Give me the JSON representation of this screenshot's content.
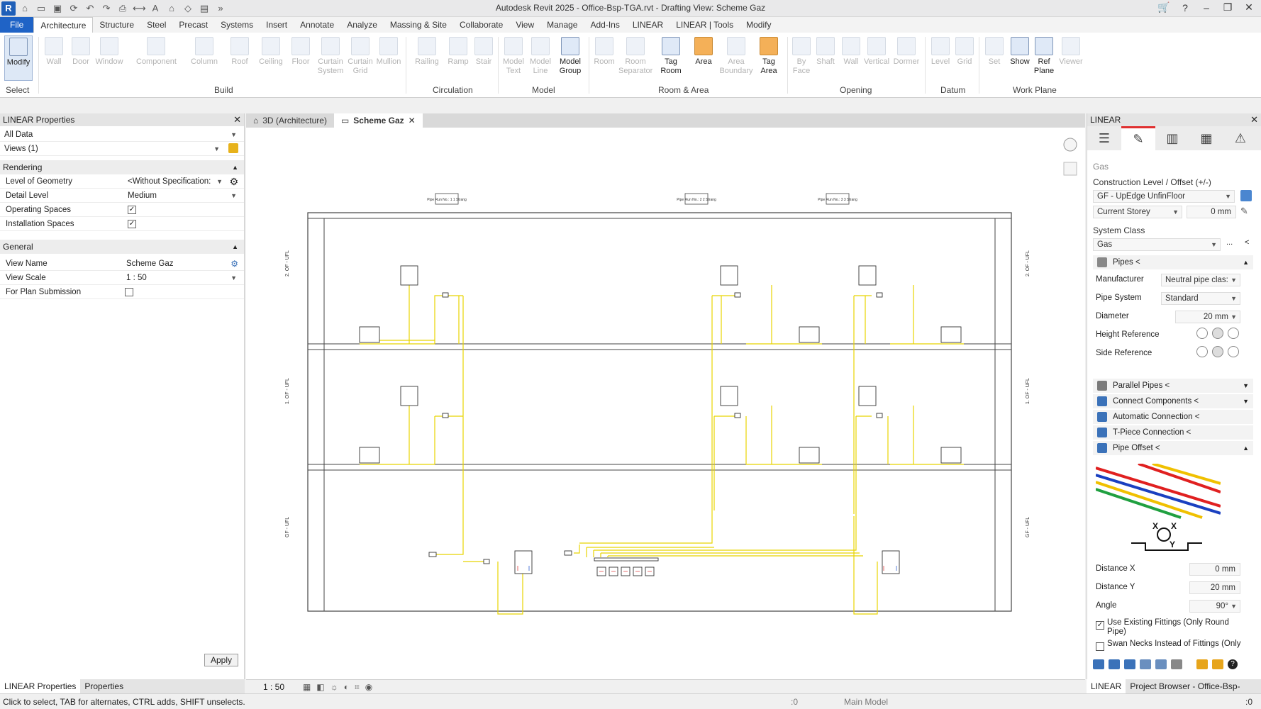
{
  "window": {
    "title": "Autodesk Revit 2025 - Office-Bsp-TGA.rvt - Drafting View: Scheme Gaz",
    "logo": "R"
  },
  "menu": {
    "tabs": [
      "File",
      "Architecture",
      "Structure",
      "Steel",
      "Precast",
      "Systems",
      "Insert",
      "Annotate",
      "Analyze",
      "Massing & Site",
      "Collaborate",
      "View",
      "Manage",
      "Add-Ins",
      "LINEAR",
      "LINEAR | Tools",
      "Modify"
    ],
    "active": "Architecture"
  },
  "ribbon": {
    "select_panel": "Select",
    "modify": "Modify",
    "build_items": [
      "Wall",
      "Door",
      "Window",
      "Component",
      "Column",
      "Roof",
      "Ceiling",
      "Floor",
      "Curtain System",
      "Curtain Grid",
      "Mullion"
    ],
    "build_panel": "Build",
    "circulation_items": [
      "Railing",
      "Ramp",
      "Stair"
    ],
    "circulation_panel": "Circulation",
    "model_items": [
      "Model Text",
      "Model Line",
      "Model Group"
    ],
    "model_panel": "Model",
    "room_items": [
      "Room",
      "Room Separator",
      "Tag Room",
      "Area",
      "Area Boundary",
      "Tag Area"
    ],
    "room_panel": "Room & Area",
    "opening_items": [
      "By Face",
      "Shaft",
      "Wall",
      "Vertical",
      "Dormer"
    ],
    "opening_panel": "Opening",
    "datum_items": [
      "Level",
      "Grid"
    ],
    "datum_panel": "Datum",
    "workplane_items": [
      "Set",
      "Show",
      "Ref Plane",
      "Viewer"
    ],
    "workplane_panel": "Work Plane"
  },
  "left_panel": {
    "title": "LINEAR Properties",
    "filter": "All Data",
    "views": "Views (1)",
    "rendering": {
      "heading": "Rendering",
      "rows": [
        {
          "key": "Level of Geometry",
          "value": "<Without Specification:"
        },
        {
          "key": "Detail Level",
          "value": "Medium"
        },
        {
          "key": "Operating Spaces",
          "value": "✓"
        },
        {
          "key": "Installation Spaces",
          "value": "✓"
        }
      ]
    },
    "general": {
      "heading": "General",
      "rows": [
        {
          "key": "View Name",
          "value": "Scheme Gaz"
        },
        {
          "key": "View Scale",
          "value": "1 : 50"
        },
        {
          "key": "For Plan Submission",
          "value": ""
        }
      ]
    },
    "apply": "Apply",
    "bottom_tabs": [
      "LINEAR Properties",
      "Properties"
    ]
  },
  "doc_tabs": [
    {
      "label": "3D (Architecture)",
      "active": false
    },
    {
      "label": "Scheme Gaz",
      "active": true
    }
  ],
  "drawing": {
    "level_labels": [
      "2. OF - UFL",
      "1. OF - UFL",
      "GF - UFL"
    ],
    "pipe_run_tags": [
      "Pipe Run No.: 1\n1 Strang",
      "Pipe Run No.: 2\n2 Strang",
      "Pipe Run No.: 3\n3 Strang"
    ],
    "pipe_color": "#e8d400"
  },
  "view_bar": {
    "scale": "1 : 50"
  },
  "right_panel": {
    "title": "LINEAR",
    "tab_icons": [
      "menu-icon",
      "edit-icon",
      "columns-icon",
      "calculator-icon",
      "warning-icon"
    ],
    "category": "Gas",
    "construction_label": "Construction Level / Offset (+/-)",
    "construction_level": "GF - UpEdge UnfinFloor",
    "storey": "Current Storey",
    "offset": "0 mm",
    "system_class_label": "System Class",
    "system_class": "Gas",
    "pipes_section": "Pipes <",
    "manufacturer_label": "Manufacturer",
    "manufacturer": "Neutral pipe clas:",
    "pipe_system_label": "Pipe System",
    "pipe_system": "Standard",
    "diameter_label": "Diameter",
    "diameter": "20 mm",
    "height_ref_label": "Height Reference",
    "side_ref_label": "Side Reference",
    "sections": [
      "Parallel Pipes <",
      "Connect Components <",
      "Automatic Connection <",
      "T-Piece Connection <",
      "Pipe Offset <"
    ],
    "distance_x_label": "Distance X",
    "distance_x": "0 mm",
    "distance_y_label": "Distance Y",
    "distance_y": "20 mm",
    "angle_label": "Angle",
    "angle": "90°",
    "use_fittings": "Use Existing Fittings (Only Round Pipe)",
    "swan_necks": "Swan Necks Instead of Fittings (Only",
    "bottom_tabs": [
      "LINEAR",
      "Project Browser - Office-Bsp-TGA.rvt"
    ]
  },
  "status_bar": {
    "message": "Click to select, TAB for alternates, CTRL adds, SHIFT unselects.",
    "zero": ":0",
    "model": "Main Model",
    "filter_count": ":0"
  }
}
